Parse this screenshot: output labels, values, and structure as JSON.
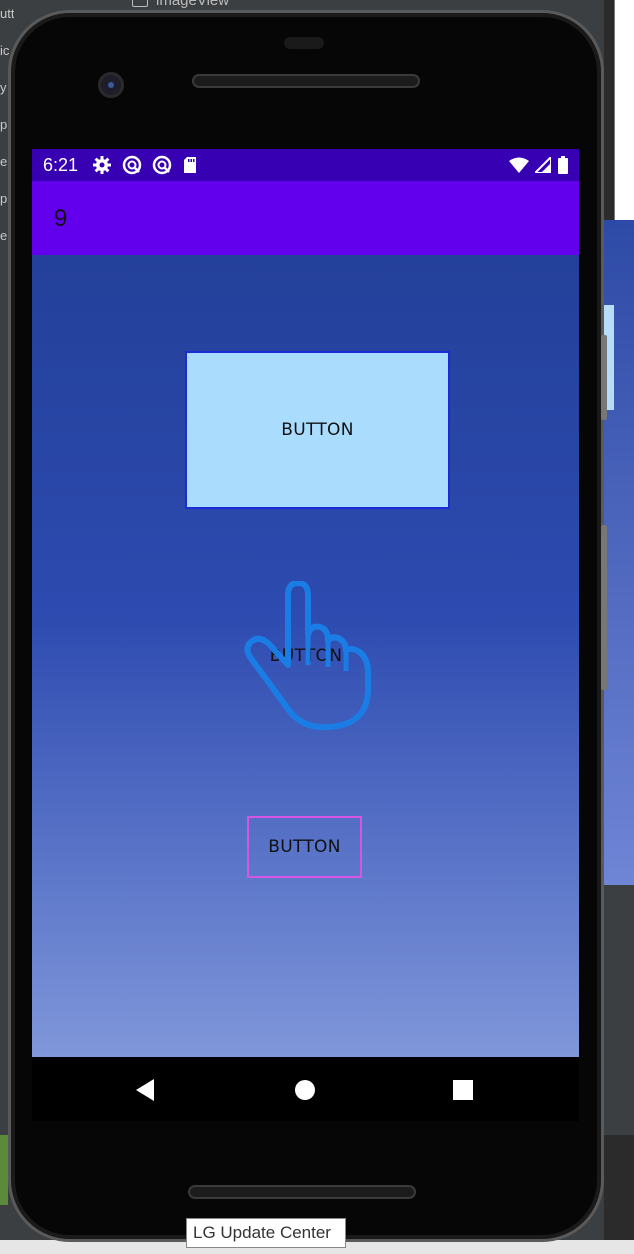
{
  "ide": {
    "left_fragments": [
      "uttons",
      "ic",
      "y",
      "p",
      "e",
      "p",
      "e"
    ],
    "top_label": "imageView"
  },
  "status_bar": {
    "time": "6:21",
    "left_icons": [
      "settings-icon",
      "sync-icon",
      "sync-icon",
      "sd-card-icon"
    ],
    "right_icons": [
      "wifi-icon",
      "signal-icon",
      "battery-icon"
    ],
    "color": "#3700b3"
  },
  "app_bar": {
    "title": "9",
    "color": "#6200ee"
  },
  "buttons": [
    {
      "label": "BUTTON",
      "style": "filled-light-blue"
    },
    {
      "label": "BUTTON",
      "style": "plain-with-hand-icon"
    },
    {
      "label": "BUTTON",
      "style": "outlined-pink"
    }
  ],
  "nav_bar": {
    "icons": [
      "back-icon",
      "home-icon",
      "recents-icon"
    ]
  },
  "tooltip": {
    "text": "LG Update Center"
  },
  "colors": {
    "button_fill": "#aadcfd",
    "button_border": "#1a2cd6",
    "outline_pink": "#d655e4",
    "hand_icon": "#1a7de6"
  }
}
